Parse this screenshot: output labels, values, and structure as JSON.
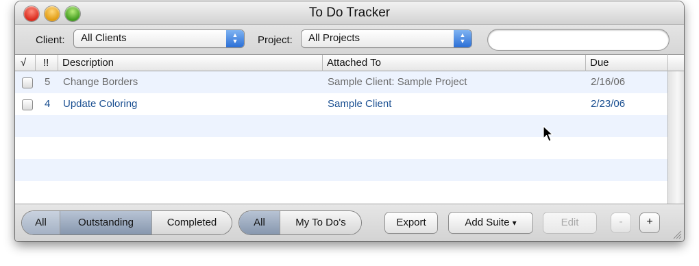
{
  "window": {
    "title": "To Do Tracker"
  },
  "toolbar": {
    "client_label": "Client:",
    "client_value": "All Clients",
    "project_label": "Project:",
    "project_value": "All Projects",
    "search_value": ""
  },
  "table": {
    "columns": [
      "√",
      "!!",
      "Description",
      "Attached To",
      "Due"
    ],
    "rows": [
      {
        "checked": false,
        "priority": "5",
        "description": "Change Borders",
        "attached_to": "Sample Client: Sample Project",
        "due": "2/16/06",
        "style": "grey"
      },
      {
        "checked": false,
        "priority": "4",
        "description": "Update Coloring",
        "attached_to": "Sample Client",
        "due": "2/23/06",
        "style": "blue"
      }
    ]
  },
  "filters": {
    "status": [
      "All",
      "Outstanding",
      "Completed"
    ],
    "status_selected": "Outstanding",
    "owner": [
      "All",
      "My To Do's"
    ],
    "owner_selected": "All"
  },
  "buttons": {
    "export": "Export",
    "add_suite": "Add Suite",
    "add_suite_arrow": "▾",
    "edit": "Edit",
    "minus": "-",
    "plus": "+"
  },
  "icons": {
    "close": "close-icon",
    "minimize": "minimize-icon",
    "zoom": "zoom-icon",
    "popup_arrows": "up-down-arrows-icon",
    "resize": "resize-grip-icon",
    "cursor": "mouse-pointer-icon"
  },
  "colors": {
    "row_alt": "#edf3fe",
    "link_blue": "#1a4f91",
    "popup_blue": "#2b6fd6",
    "segment_selected": "#8797ae"
  }
}
